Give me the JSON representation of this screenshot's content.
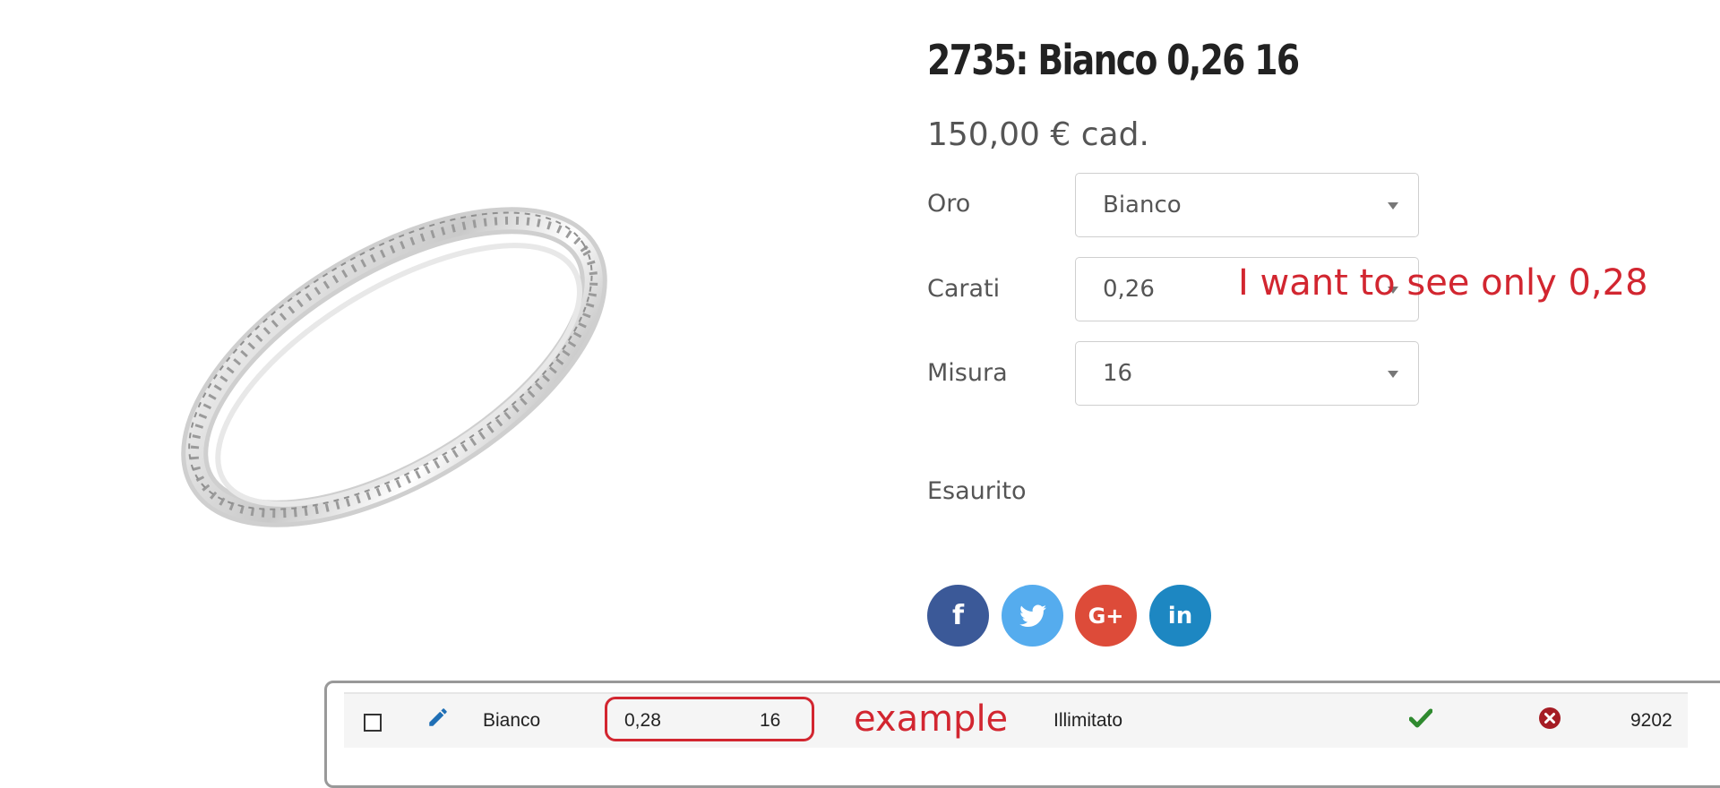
{
  "product": {
    "title": "2735: Bianco 0,26 16",
    "price": "150,00 € cad."
  },
  "options": [
    {
      "label": "Oro",
      "value": "Bianco"
    },
    {
      "label": "Carati",
      "value": "0,26"
    },
    {
      "label": "Misura",
      "value": "16"
    }
  ],
  "stock_status": "Esaurito",
  "social": {
    "facebook": "f",
    "twitter": "twitter-icon",
    "google_plus": "G+",
    "linkedin": "in"
  },
  "annotations": {
    "top": "I want to see only 0,28",
    "bottom": "example",
    "color": "#d22630"
  },
  "admin_row": {
    "color": "Bianco",
    "carati": "0,28",
    "misura": "16",
    "quantity": "Illimitato",
    "id": "9202"
  }
}
